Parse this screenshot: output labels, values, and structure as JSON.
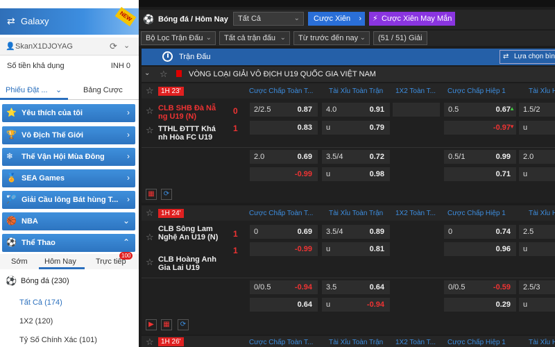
{
  "sidebar": {
    "brand": "Galaxy",
    "brand_badge": "NEW",
    "username": "SkanX1DJOYAG",
    "balance_label": "Số tiền khả dụng",
    "balance_value": "INH 0",
    "tab_bets": "Phiếu Đặt ...",
    "tab_odds": "Bảng Cược",
    "menu": [
      {
        "label": "Yêu thích của tôi"
      },
      {
        "label": "Vô Địch Thế Giới"
      },
      {
        "label": "Thế Vận Hội Mùa Đông"
      },
      {
        "label": "SEA Games"
      },
      {
        "label": "Giải Cầu lông Bát hùng T..."
      },
      {
        "label": "NBA"
      },
      {
        "label": "Thể Thao"
      }
    ],
    "sub_tabs": {
      "early": "Sớm",
      "today": "Hôm Nay",
      "live": "Trực tiếp",
      "live_badge": "100"
    },
    "sport": "Bóng đá (230)",
    "sub_items": [
      "Tất Cả (174)",
      "1X2 (120)",
      "Tỷ Số Chính Xác (101)"
    ]
  },
  "header": {
    "crumb": "Bóng đá / Hôm Nay",
    "select": "Tất Cả",
    "parlay": "Cược Xiên",
    "lucky": "Cược Xiên May Mắn"
  },
  "filters": {
    "f1": "Bộ Lọc Trận Đấu",
    "f2": "Tất cả trận đấu",
    "f3": "Từ trước đến nay",
    "f4": "(51 / 51) Giải"
  },
  "section": {
    "title": "Trận Đấu",
    "choose": "Lựa chọn bình"
  },
  "league": "VÒNG LOẠI GIẢI VÔ ĐỊCH U19 QUỐC GIA VIỆT NAM",
  "columns": [
    "Cược Chấp Toàn T...",
    "Tài Xỉu Toàn Trận",
    "1X2 Toàn T...",
    "Cược Chấp Hiệp 1",
    "Tài Xỉu H"
  ],
  "matches": [
    {
      "time": "1H 23'",
      "home": "CLB SHB Đà Nẵ ng U19 (N)",
      "away": "TTHL ĐTTT Khá nh Hòa FC U19",
      "home_score": "0",
      "away_score": "1",
      "r1": {
        "h_line": "2/2.5",
        "h_odd": "0.87",
        "ou_line": "4.0",
        "ou_odd": "0.91",
        "h1_line": "0.5",
        "h1_odd": "0.67",
        "ou1_line": "1.5/2"
      },
      "r2": {
        "h_odd": "0.83",
        "ou_line": "u",
        "ou_odd": "0.79",
        "h1_odd": "-0.97",
        "ou1_line": "u"
      },
      "r3": {
        "h_line": "2.0",
        "h_odd": "0.69",
        "ou_line": "3.5/4",
        "ou_odd": "0.72",
        "h1_line": "0.5/1",
        "h1_odd": "0.99",
        "ou1_line": "2.0"
      },
      "r4": {
        "h_odd": "-0.99",
        "ou_line": "u",
        "ou_odd": "0.98",
        "h1_odd": "0.71",
        "ou1_line": "u"
      }
    },
    {
      "time": "1H 24'",
      "home": "CLB Sông Lam Nghệ An U19 (N)",
      "away": "CLB Hoàng Anh Gia Lai U19",
      "home_score": "1",
      "away_score": "1",
      "r1": {
        "h_line": "0",
        "h_odd": "0.69",
        "ou_line": "3.5/4",
        "ou_odd": "0.89",
        "h1_line": "0",
        "h1_odd": "0.74",
        "ou1_line": "2.5"
      },
      "r2": {
        "h_odd": "-0.99",
        "ou_line": "u",
        "ou_odd": "0.81",
        "h1_odd": "0.96",
        "ou1_line": "u"
      },
      "r3": {
        "h_line": "0/0.5",
        "h_odd": "-0.94",
        "ou_line": "3.5",
        "ou_odd": "0.64",
        "h1_line": "0/0.5",
        "h1_odd": "-0.59",
        "ou1_line": "2.5/3"
      },
      "r4": {
        "h_odd": "0.64",
        "ou_line": "u",
        "ou_odd": "-0.94",
        "h1_odd": "0.29",
        "ou1_line": "u"
      }
    },
    {
      "time": "1H 26'"
    }
  ]
}
